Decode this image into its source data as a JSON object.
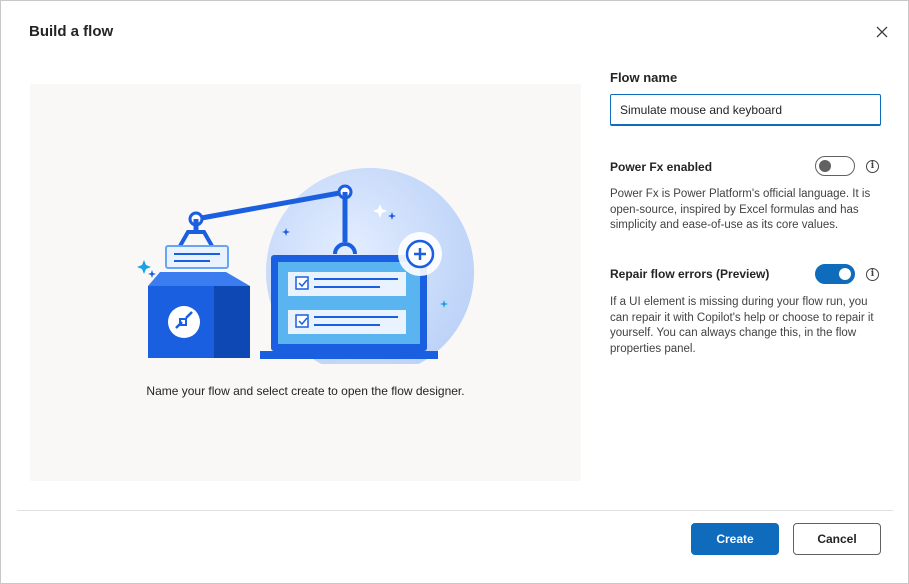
{
  "dialog": {
    "title": "Build a flow",
    "close_icon": "close-icon"
  },
  "illustration": {
    "caption": "Name your flow and select create to open the flow designer."
  },
  "form": {
    "flow_name_label": "Flow name",
    "flow_name_value": "Simulate mouse and keyboard",
    "power_fx": {
      "label": "Power Fx enabled",
      "enabled": false,
      "description": "Power Fx is Power Platform's official language. It is open-source, inspired by Excel formulas and has simplicity and ease-of-use as its core values.",
      "info_icon": "info-icon"
    },
    "repair": {
      "label": "Repair flow errors (Preview)",
      "enabled": true,
      "description": "If a UI element is missing during your flow run, you can repair it with Copilot's help or choose to repair it yourself. You can always change this, in the flow properties panel.",
      "info_icon": "info-icon"
    }
  },
  "footer": {
    "create_label": "Create",
    "cancel_label": "Cancel"
  },
  "colors": {
    "accent": "#0f6cbd",
    "panel_bg": "#f9f8f7"
  }
}
